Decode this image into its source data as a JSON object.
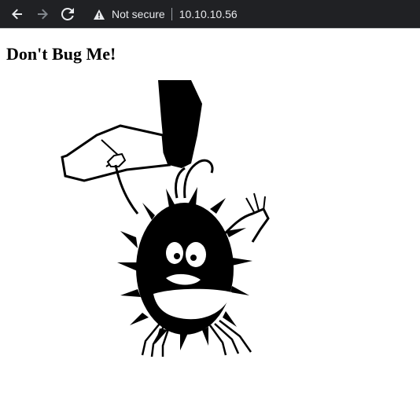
{
  "browser": {
    "icons": {
      "back": "arrow-left-icon",
      "forward": "arrow-right-icon",
      "reload": "reload-icon",
      "security": "warning-triangle-icon"
    },
    "security_label": "Not secure",
    "url": "10.10.10.56",
    "colors": {
      "toolbar_bg": "#202124",
      "toolbar_text": "#e8eaed",
      "forward_disabled": "#80868b"
    }
  },
  "page": {
    "heading": "Don't Bug Me!",
    "image": {
      "subject": "bug-image"
    }
  }
}
